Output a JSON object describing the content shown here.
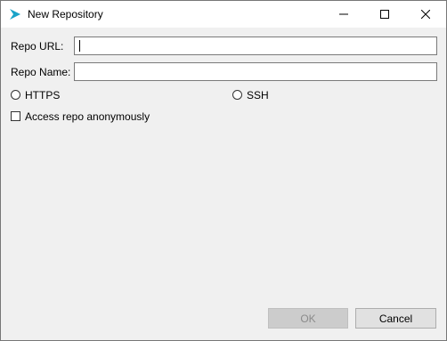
{
  "window": {
    "title": "New Repository",
    "controls": {
      "minimize": "minimize",
      "maximize": "maximize",
      "close": "close"
    }
  },
  "form": {
    "repo_url_label": "Repo URL:",
    "repo_url_value": "",
    "repo_name_label": "Repo Name:",
    "repo_name_value": "",
    "protocol_options": [
      {
        "label": "HTTPS",
        "selected": false
      },
      {
        "label": "SSH",
        "selected": false
      }
    ],
    "anonymous_label": "Access repo anonymously",
    "anonymous_checked": false
  },
  "buttons": {
    "ok_label": "OK",
    "ok_enabled": false,
    "cancel_label": "Cancel"
  },
  "colors": {
    "app_icon": "#1aa3c8",
    "window_bg": "#f0f0f0",
    "disabled_button_bg": "#cccccc"
  }
}
